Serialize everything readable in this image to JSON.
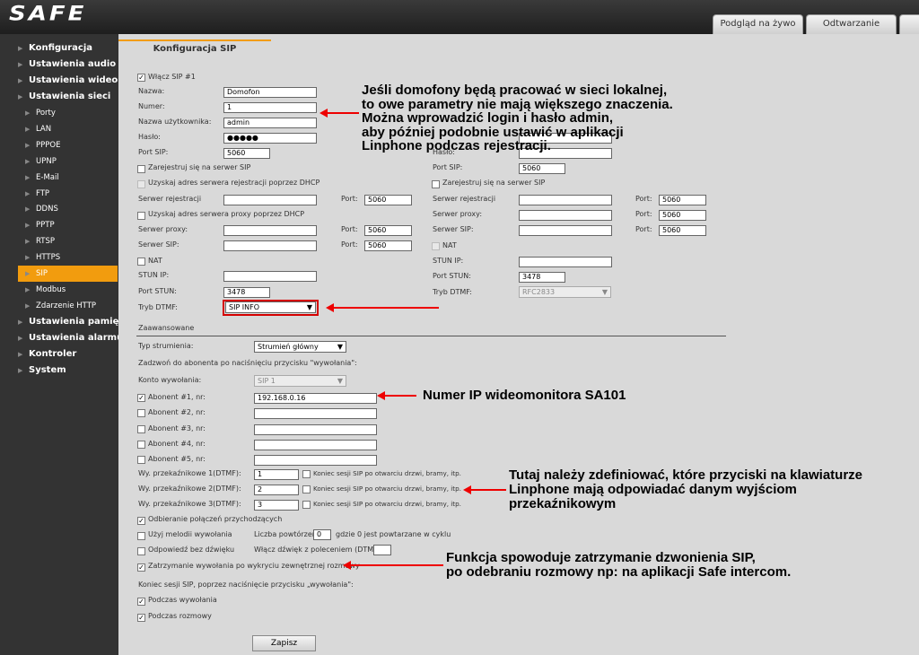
{
  "header": {
    "logo": "SAFE",
    "tabs": [
      "Podgląd na żywo",
      "Odtwarzanie"
    ]
  },
  "sidebar": [
    {
      "label": "Konfiguracja",
      "level": 0
    },
    {
      "label": "Ustawienia audio",
      "level": 0
    },
    {
      "label": "Ustawienia wideo",
      "level": 0
    },
    {
      "label": "Ustawienia sieci",
      "level": 0
    },
    {
      "label": "Porty",
      "level": 1
    },
    {
      "label": "LAN",
      "level": 1
    },
    {
      "label": "PPPOE",
      "level": 1
    },
    {
      "label": "UPNP",
      "level": 1
    },
    {
      "label": "E-Mail",
      "level": 1
    },
    {
      "label": "FTP",
      "level": 1
    },
    {
      "label": "DDNS",
      "level": 1
    },
    {
      "label": "PPTP",
      "level": 1
    },
    {
      "label": "RTSP",
      "level": 1
    },
    {
      "label": "HTTPS",
      "level": 1
    },
    {
      "label": "SIP",
      "level": 1,
      "active": true
    },
    {
      "label": "Modbus",
      "level": 1
    },
    {
      "label": "Zdarzenie HTTP",
      "level": 1
    },
    {
      "label": "Ustawienia pamięci",
      "level": 0
    },
    {
      "label": "Ustawienia alarmu",
      "level": 0
    },
    {
      "label": "Kontroler",
      "level": 0
    },
    {
      "label": "System",
      "level": 0
    }
  ],
  "page_tab": "Konfiguracja SIP",
  "sip1": {
    "enable_label": "Włącz SIP #1",
    "name_label": "Nazwa:",
    "name_value": "Domofon",
    "number_label": "Numer:",
    "number_value": "1",
    "user_label": "Nazwa użytkownika:",
    "user_value": "admin",
    "pass_label": "Hasło:",
    "pass_value": "●●●●●",
    "port_label": "Port SIP:",
    "port_value": "5060",
    "register_label": "Zarejestruj się na serwer SIP",
    "dhcp_reg_label": "Uzyskaj adres serwera rejestracji poprzez DHCP",
    "reg_server_label": "Serwer rejestracji",
    "port_short": "Port:",
    "reg_port": "5060",
    "dhcp_proxy_label": "Uzyskaj adres serwera proxy poprzez DHCP",
    "proxy_label": "Serwer proxy:",
    "proxy_port": "5060",
    "sip_server_label": "Serwer SIP:",
    "sip_server_port": "5060",
    "nat_label": "NAT",
    "stun_ip_label": "STUN IP:",
    "stun_port_label": "Port STUN:",
    "stun_port_value": "3478",
    "dtmf_label": "Tryb DTMF:",
    "dtmf_value": "SIP INFO"
  },
  "sip2": {
    "pass_label": "Hasło:",
    "port_label": "Port SIP:",
    "port_value": "5060",
    "register_label": "Zarejestruj się na serwer SIP",
    "reg_server_label": "Serwer rejestracji",
    "reg_port": "5060",
    "proxy_label": "Serwer proxy:",
    "proxy_port": "5060",
    "sip_server_label": "Serwer SIP:",
    "sip_server_port": "5060",
    "nat_label": "NAT",
    "stun_ip_label": "STUN IP:",
    "stun_port_label": "Port STUN:",
    "stun_port_value": "3478",
    "dtmf_label": "Tryb DTMF:",
    "dtmf_value": "RFC2833"
  },
  "advanced": {
    "section_label": "Zaawansowane",
    "stream_label": "Typ strumienia:",
    "stream_value": "Strumień główny",
    "call_info": "Zadzwoń do abonenta po naciśnięciu przycisku \"wywołania\":",
    "account_label": "Konto wywołania:",
    "account_value": "SIP 1",
    "subscribers": [
      {
        "label": "Abonent #1, nr:",
        "value": "192.168.0.16",
        "checked": true
      },
      {
        "label": "Abonent #2, nr:",
        "value": "",
        "checked": false
      },
      {
        "label": "Abonent #3, nr:",
        "value": "",
        "checked": false
      },
      {
        "label": "Abonent #4, nr:",
        "value": "",
        "checked": false
      },
      {
        "label": "Abonent #5, nr:",
        "value": "",
        "checked": false
      }
    ],
    "relays": [
      {
        "label": "Wy. przekaźnikowe 1(DTMF):",
        "value": "1",
        "end_label": "Koniec sesji SIP po otwarciu drzwi, bramy, itp."
      },
      {
        "label": "Wy. przekaźnikowe 2(DTMF):",
        "value": "2",
        "end_label": "Koniec sesji SIP po otwarciu drzwi, bramy, itp."
      },
      {
        "label": "Wy. przekaźnikowe 3(DTMF):",
        "value": "3",
        "end_label": "Koniec sesji SIP po otwarciu drzwi, bramy, itp."
      }
    ],
    "incoming_label": "Odbieranie połączeń przychodzących",
    "melody_label": "Użyj melodii wywołania",
    "repeat_label": "Liczba powtórzeń",
    "repeat_value": "0",
    "repeat_hint": "gdzie 0 jest powtarzane w cyklu",
    "silent_label": "Odpowiedź bez dźwięku",
    "dtmf_sound_label": "Włącz dźwięk z poleceniem (DTMF)",
    "stop_call_label": "Zatrzymanie wywołania po wykryciu zewnętrznej rozmowy",
    "end_session_label": "Koniec sesji SIP, poprzez naciśnięcie przycisku „wywołania\":",
    "during_call_label": "Podczas wywołania",
    "during_talk_label": "Podczas rozmowy",
    "save_label": "Zapisz"
  },
  "annotations": {
    "a1": [
      "Jeśli domofony będą pracować w sieci lokalnej,",
      "to owe parametry nie mają większego znaczenia.",
      "Można wprowadzić  login i hasło admin,",
      "aby później podobnie ustawić w aplikacji",
      "Linphone podczas rejestracji."
    ],
    "a2": "Numer IP wideomonitora SA101",
    "a3": [
      "Tutaj należy zdefiniować, które przyciski na klawiaturze",
      "Linphone mają odpowiadać danym wyjściom",
      "przekaźnikowym"
    ],
    "a4": [
      "Funkcja spowoduje zatrzymanie dzwonienia SIP,",
      "po odebraniu rozmowy np: na aplikacji Safe intercom."
    ]
  },
  "colors": {
    "accent": "#f29c0e",
    "arrow": "#e00000",
    "highlight_border": "#d40000"
  }
}
